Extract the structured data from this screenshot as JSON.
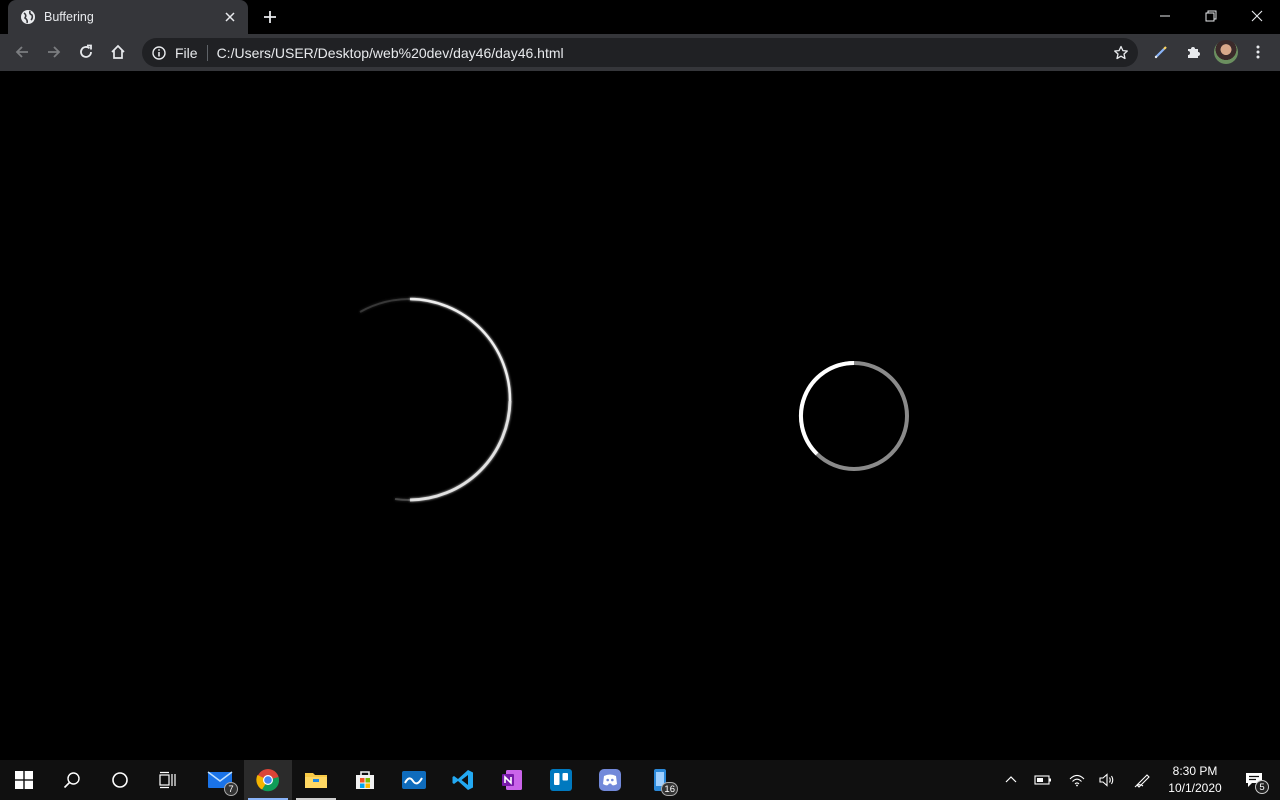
{
  "browser": {
    "tab": {
      "title": "Buffering"
    },
    "omnibox": {
      "scheme_label": "File",
      "url": "C:/Users/USER/Desktop/web%20dev/day46/day46.html"
    }
  },
  "taskbar": {
    "apps": [
      {
        "name": "mail",
        "badge": "7"
      },
      {
        "name": "chrome",
        "badge": ""
      },
      {
        "name": "file-explorer",
        "badge": ""
      },
      {
        "name": "microsoft-store",
        "badge": ""
      },
      {
        "name": "whiteboard",
        "badge": ""
      },
      {
        "name": "vscode",
        "badge": ""
      },
      {
        "name": "onenote",
        "badge": ""
      },
      {
        "name": "trello",
        "badge": ""
      },
      {
        "name": "discord",
        "badge": ""
      },
      {
        "name": "phone",
        "badge": "16"
      }
    ],
    "clock": {
      "time": "8:30 PM",
      "date": "10/1/2020"
    },
    "notification_count": "5"
  },
  "colors": {
    "toolbar": "#35363a",
    "omnibox": "#202124",
    "page_background": "#000000",
    "taskbar": "#101010"
  }
}
